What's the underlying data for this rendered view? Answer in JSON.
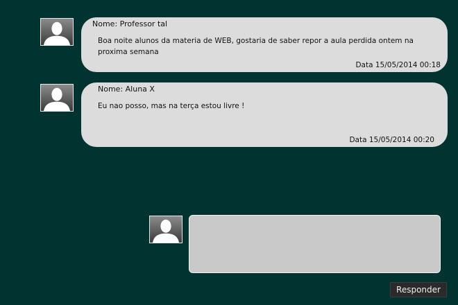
{
  "messages": [
    {
      "name": "Nome: Professor tal",
      "text": "Boa noite alunos da materia de WEB, gostaria de saber repor a aula perdida ontem na proxima semana",
      "date": "Data 15/05/2014  00:18",
      "avatar_icon": "user-silhouette-icon"
    },
    {
      "name": "Nome: Aluna X",
      "text": "Eu nao posso, mas na terça estou livre !",
      "date": "Data 15/05/2014  00:20",
      "avatar_icon": "user-silhouette-icon"
    }
  ],
  "reply": {
    "value": "",
    "placeholder": "",
    "button_label": "Responder",
    "avatar_icon": "user-silhouette-icon"
  },
  "colors": {
    "background": "#013330",
    "bubble": "#dcdcdc",
    "reply_box": "#c9c9c9",
    "button": "#2a2a2a"
  }
}
